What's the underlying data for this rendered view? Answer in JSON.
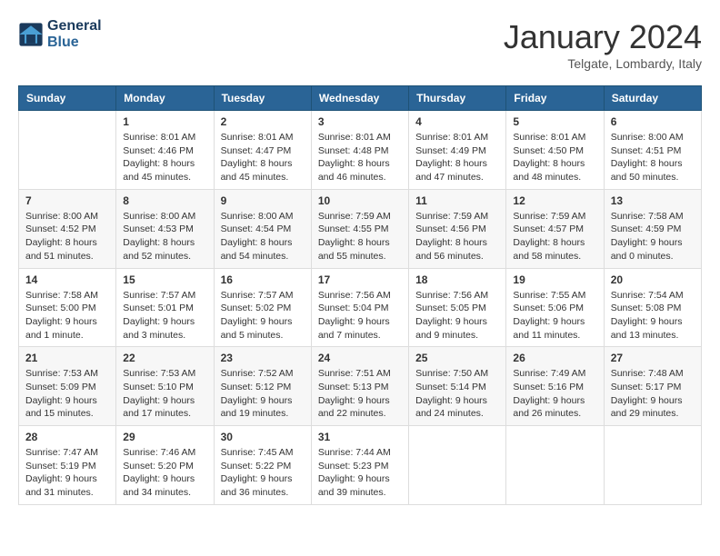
{
  "header": {
    "logo_line1": "General",
    "logo_line2": "Blue",
    "month_title": "January 2024",
    "location": "Telgate, Lombardy, Italy"
  },
  "weekdays": [
    "Sunday",
    "Monday",
    "Tuesday",
    "Wednesday",
    "Thursday",
    "Friday",
    "Saturday"
  ],
  "weeks": [
    [
      {
        "day": "",
        "info": ""
      },
      {
        "day": "1",
        "info": "Sunrise: 8:01 AM\nSunset: 4:46 PM\nDaylight: 8 hours\nand 45 minutes."
      },
      {
        "day": "2",
        "info": "Sunrise: 8:01 AM\nSunset: 4:47 PM\nDaylight: 8 hours\nand 45 minutes."
      },
      {
        "day": "3",
        "info": "Sunrise: 8:01 AM\nSunset: 4:48 PM\nDaylight: 8 hours\nand 46 minutes."
      },
      {
        "day": "4",
        "info": "Sunrise: 8:01 AM\nSunset: 4:49 PM\nDaylight: 8 hours\nand 47 minutes."
      },
      {
        "day": "5",
        "info": "Sunrise: 8:01 AM\nSunset: 4:50 PM\nDaylight: 8 hours\nand 48 minutes."
      },
      {
        "day": "6",
        "info": "Sunrise: 8:00 AM\nSunset: 4:51 PM\nDaylight: 8 hours\nand 50 minutes."
      }
    ],
    [
      {
        "day": "7",
        "info": "Sunrise: 8:00 AM\nSunset: 4:52 PM\nDaylight: 8 hours\nand 51 minutes."
      },
      {
        "day": "8",
        "info": "Sunrise: 8:00 AM\nSunset: 4:53 PM\nDaylight: 8 hours\nand 52 minutes."
      },
      {
        "day": "9",
        "info": "Sunrise: 8:00 AM\nSunset: 4:54 PM\nDaylight: 8 hours\nand 54 minutes."
      },
      {
        "day": "10",
        "info": "Sunrise: 7:59 AM\nSunset: 4:55 PM\nDaylight: 8 hours\nand 55 minutes."
      },
      {
        "day": "11",
        "info": "Sunrise: 7:59 AM\nSunset: 4:56 PM\nDaylight: 8 hours\nand 56 minutes."
      },
      {
        "day": "12",
        "info": "Sunrise: 7:59 AM\nSunset: 4:57 PM\nDaylight: 8 hours\nand 58 minutes."
      },
      {
        "day": "13",
        "info": "Sunrise: 7:58 AM\nSunset: 4:59 PM\nDaylight: 9 hours\nand 0 minutes."
      }
    ],
    [
      {
        "day": "14",
        "info": "Sunrise: 7:58 AM\nSunset: 5:00 PM\nDaylight: 9 hours\nand 1 minute."
      },
      {
        "day": "15",
        "info": "Sunrise: 7:57 AM\nSunset: 5:01 PM\nDaylight: 9 hours\nand 3 minutes."
      },
      {
        "day": "16",
        "info": "Sunrise: 7:57 AM\nSunset: 5:02 PM\nDaylight: 9 hours\nand 5 minutes."
      },
      {
        "day": "17",
        "info": "Sunrise: 7:56 AM\nSunset: 5:04 PM\nDaylight: 9 hours\nand 7 minutes."
      },
      {
        "day": "18",
        "info": "Sunrise: 7:56 AM\nSunset: 5:05 PM\nDaylight: 9 hours\nand 9 minutes."
      },
      {
        "day": "19",
        "info": "Sunrise: 7:55 AM\nSunset: 5:06 PM\nDaylight: 9 hours\nand 11 minutes."
      },
      {
        "day": "20",
        "info": "Sunrise: 7:54 AM\nSunset: 5:08 PM\nDaylight: 9 hours\nand 13 minutes."
      }
    ],
    [
      {
        "day": "21",
        "info": "Sunrise: 7:53 AM\nSunset: 5:09 PM\nDaylight: 9 hours\nand 15 minutes."
      },
      {
        "day": "22",
        "info": "Sunrise: 7:53 AM\nSunset: 5:10 PM\nDaylight: 9 hours\nand 17 minutes."
      },
      {
        "day": "23",
        "info": "Sunrise: 7:52 AM\nSunset: 5:12 PM\nDaylight: 9 hours\nand 19 minutes."
      },
      {
        "day": "24",
        "info": "Sunrise: 7:51 AM\nSunset: 5:13 PM\nDaylight: 9 hours\nand 22 minutes."
      },
      {
        "day": "25",
        "info": "Sunrise: 7:50 AM\nSunset: 5:14 PM\nDaylight: 9 hours\nand 24 minutes."
      },
      {
        "day": "26",
        "info": "Sunrise: 7:49 AM\nSunset: 5:16 PM\nDaylight: 9 hours\nand 26 minutes."
      },
      {
        "day": "27",
        "info": "Sunrise: 7:48 AM\nSunset: 5:17 PM\nDaylight: 9 hours\nand 29 minutes."
      }
    ],
    [
      {
        "day": "28",
        "info": "Sunrise: 7:47 AM\nSunset: 5:19 PM\nDaylight: 9 hours\nand 31 minutes."
      },
      {
        "day": "29",
        "info": "Sunrise: 7:46 AM\nSunset: 5:20 PM\nDaylight: 9 hours\nand 34 minutes."
      },
      {
        "day": "30",
        "info": "Sunrise: 7:45 AM\nSunset: 5:22 PM\nDaylight: 9 hours\nand 36 minutes."
      },
      {
        "day": "31",
        "info": "Sunrise: 7:44 AM\nSunset: 5:23 PM\nDaylight: 9 hours\nand 39 minutes."
      },
      {
        "day": "",
        "info": ""
      },
      {
        "day": "",
        "info": ""
      },
      {
        "day": "",
        "info": ""
      }
    ]
  ]
}
